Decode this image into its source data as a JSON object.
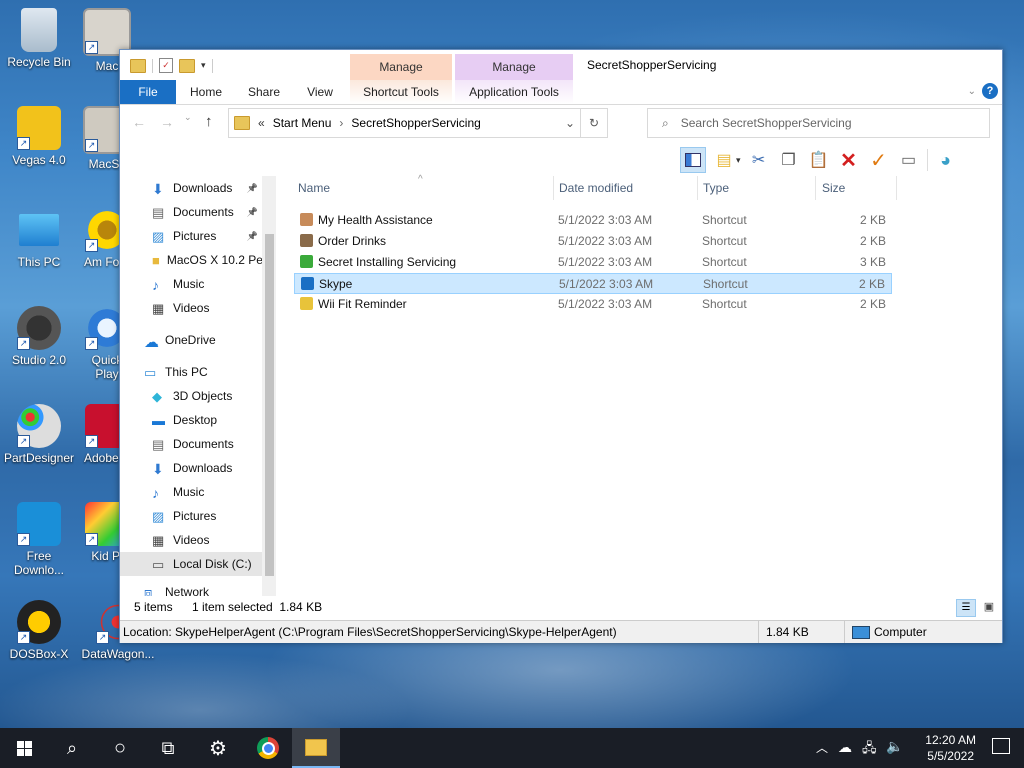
{
  "desktop": {
    "icons": [
      {
        "label": "Recycle Bin"
      },
      {
        "label": "Mac"
      },
      {
        "label": "Vegas 4.0"
      },
      {
        "label": "MacSy"
      },
      {
        "label": "This PC"
      },
      {
        "label": "Am Fore"
      },
      {
        "label": "Studio 2.0"
      },
      {
        "label": "Quick Play"
      },
      {
        "label": "PartDesigner"
      },
      {
        "label": "Adobe X"
      },
      {
        "label": "Free Downlo..."
      },
      {
        "label": "Kid Pi"
      },
      {
        "label": "DOSBox-X"
      },
      {
        "label": "DataWagon..."
      }
    ]
  },
  "window": {
    "title": "SecretShopperServicing",
    "context_tabs": [
      {
        "group": "Manage",
        "tab": "Shortcut Tools",
        "color": "#fcd7c3"
      },
      {
        "group": "Manage",
        "tab": "Application Tools",
        "color": "#e7cdf3"
      }
    ],
    "ribbon_tabs": [
      "File",
      "Home",
      "Share",
      "View"
    ],
    "address": {
      "prefix": "«",
      "crumbs": [
        "Start Menu",
        "SecretShopperServicing"
      ]
    },
    "search_placeholder": "Search SecretShopperServicing",
    "nav": [
      {
        "label": "Downloads",
        "icon": "download-arrow-icon",
        "pinned": true
      },
      {
        "label": "Documents",
        "icon": "document-icon",
        "pinned": true
      },
      {
        "label": "Pictures",
        "icon": "pictures-icon",
        "pinned": true
      },
      {
        "label": "MacOS X 10.2 Pe",
        "icon": "folder-icon",
        "pinned": false
      },
      {
        "label": "Music",
        "icon": "music-note-icon",
        "pinned": false
      },
      {
        "label": "Videos",
        "icon": "film-icon",
        "pinned": false
      },
      {
        "label": "OneDrive",
        "icon": "cloud-icon",
        "pinned": false
      },
      {
        "label": "This PC",
        "icon": "computer-icon",
        "pinned": false
      },
      {
        "label": "3D Objects",
        "icon": "cube-icon",
        "pinned": false
      },
      {
        "label": "Desktop",
        "icon": "desktop-icon",
        "pinned": false
      },
      {
        "label": "Documents",
        "icon": "document-icon",
        "pinned": false
      },
      {
        "label": "Downloads",
        "icon": "download-arrow-icon",
        "pinned": false
      },
      {
        "label": "Music",
        "icon": "music-note-icon",
        "pinned": false
      },
      {
        "label": "Pictures",
        "icon": "pictures-icon",
        "pinned": false
      },
      {
        "label": "Videos",
        "icon": "film-icon",
        "pinned": false
      },
      {
        "label": "Local Disk (C:)",
        "icon": "drive-icon",
        "pinned": false
      },
      {
        "label": "Network",
        "icon": "network-icon",
        "pinned": false
      }
    ],
    "columns": [
      "Name",
      "Date modified",
      "Type",
      "Size"
    ],
    "files": [
      {
        "name": "My Health Assistance",
        "date": "5/1/2022 3:03 AM",
        "type": "Shortcut",
        "size": "2 KB",
        "selected": false
      },
      {
        "name": "Order Drinks",
        "date": "5/1/2022 3:03 AM",
        "type": "Shortcut",
        "size": "2 KB",
        "selected": false
      },
      {
        "name": "Secret Installing Servicing",
        "date": "5/1/2022 3:03 AM",
        "type": "Shortcut",
        "size": "3 KB",
        "selected": false
      },
      {
        "name": "Skype",
        "date": "5/1/2022 3:03 AM",
        "type": "Shortcut",
        "size": "2 KB",
        "selected": true
      },
      {
        "name": "Wii Fit Reminder",
        "date": "5/1/2022 3:03 AM",
        "type": "Shortcut",
        "size": "2 KB",
        "selected": false
      }
    ],
    "status": {
      "items": "5 items",
      "selected": "1 item selected  1.84 KB"
    },
    "detail": {
      "location": "Location: SkypeHelperAgent (C:\\Program Files\\SecretShopperServicing\\Skype-HelperAgent)",
      "size": "1.84 KB",
      "computer": "Computer"
    }
  },
  "taskbar": {
    "time": "12:20 AM",
    "date": "5/5/2022"
  }
}
